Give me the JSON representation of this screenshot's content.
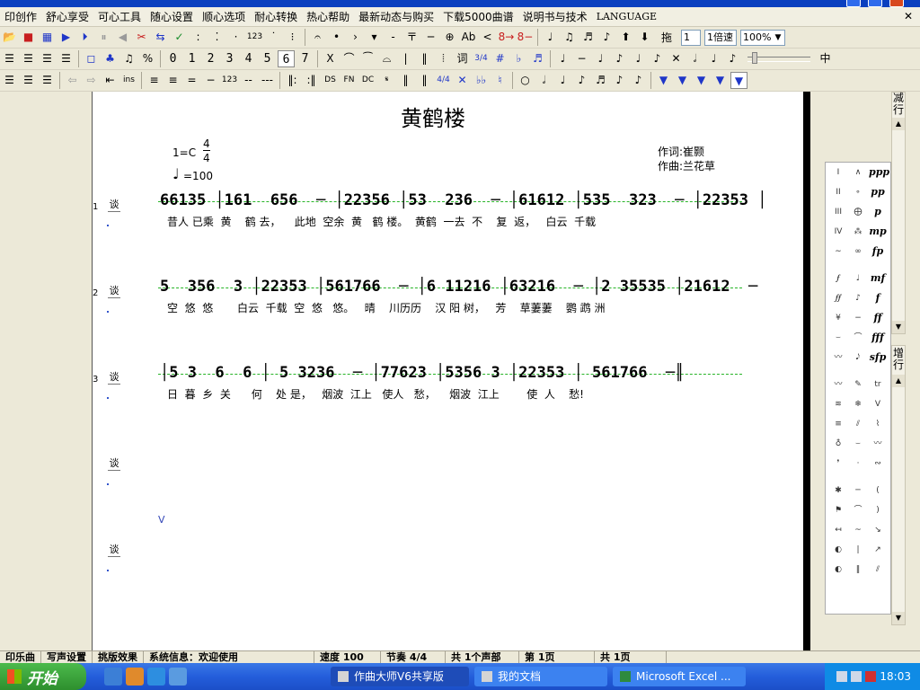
{
  "menu": [
    "印创作",
    "舒心享受",
    "可心工具",
    "随心设置",
    "顺心选项",
    "耐心转换",
    "热心帮助",
    "最新动态与购买",
    "下载5000曲谱",
    "说明书与技术",
    "LANGUAGE"
  ],
  "toolbar1": {
    "notes_label": "123",
    "ab_label": "Ab",
    "n8a": "8→",
    "n8b": "8−",
    "drag_label": "拖",
    "page_field": "1",
    "speed_field": "1倍速",
    "zoom_field": "100%"
  },
  "toolbar2": {
    "digits": [
      "0",
      "1",
      "2",
      "3",
      "4",
      "5",
      "6",
      "7"
    ],
    "x_label": "X",
    "ci_label": "词",
    "time_sig": "3/4",
    "sharp": "#",
    "flat": "♭",
    "center_label": "中"
  },
  "toolbar3": {
    "ins_label": "ins",
    "num_label": "123",
    "ds": "DS",
    "fn": "FN",
    "dc": "DC",
    "time_sig": "4/4",
    "dbl_flat": "♭♭"
  },
  "score": {
    "title": "黄鹤楼",
    "lyricist": "作词:崔颢",
    "composer": "作曲:兰花草",
    "key": "1=C",
    "time_top": "4",
    "time_bottom": "4",
    "tempo": "=100",
    "row_icon": "谈",
    "v_marker": "V",
    "rows": [
      {
        "num": "1",
        "notes": "66135 │161  656  ─ │22356 │53  236  ─ │61612 │535  323  ─ │22353 │",
        "lyrics": "昔人 已乘  黄    鹤 去，    此地  空余  黄   鹤 楼。  黄鹤  一去  不    复  返，   白云  千载"
      },
      {
        "num": "2",
        "notes": "5  356  3 │22353 │561766  ─ │6 11216 │63216  ─ │2 35535 │21612  ─",
        "lyrics": "空  悠  悠       白云  千载  空  悠   悠。   晴    川历历    汉 阳 树，   芳    草萋萋    鹦 鹉 洲"
      },
      {
        "num": "3",
        "notes": "│5 3  6  6 │ 5 3236  ─ │77623 │5356 3 │22353 │ 561766  ─║",
        "lyrics": "日  暮  乡  关      何    处 是，   烟波  江上   使人   愁，    烟波  江上        使  人    愁!"
      }
    ]
  },
  "right_pane": {
    "top_label": "减行",
    "bottom_label": "增行"
  },
  "palette": {
    "dynamics": [
      "ppp",
      "pp",
      "p",
      "mp",
      "fp",
      "mf",
      "f",
      "ff",
      "fff",
      "sfp"
    ],
    "roman": [
      "I",
      "II",
      "III",
      "IV"
    ],
    "tr": "tr"
  },
  "status": [
    "印乐曲",
    "写声设置",
    "挑版效果",
    "系统信息：欢迎使用",
    "速度 100",
    "节奏 4/4",
    "共 1个声部",
    "第 1页",
    "共 1页"
  ],
  "taskbar": {
    "start": "开始",
    "tasks": [
      "作曲大师V6共享版",
      "我的文档",
      "Microsoft Excel ..."
    ],
    "clock": "18:03"
  }
}
